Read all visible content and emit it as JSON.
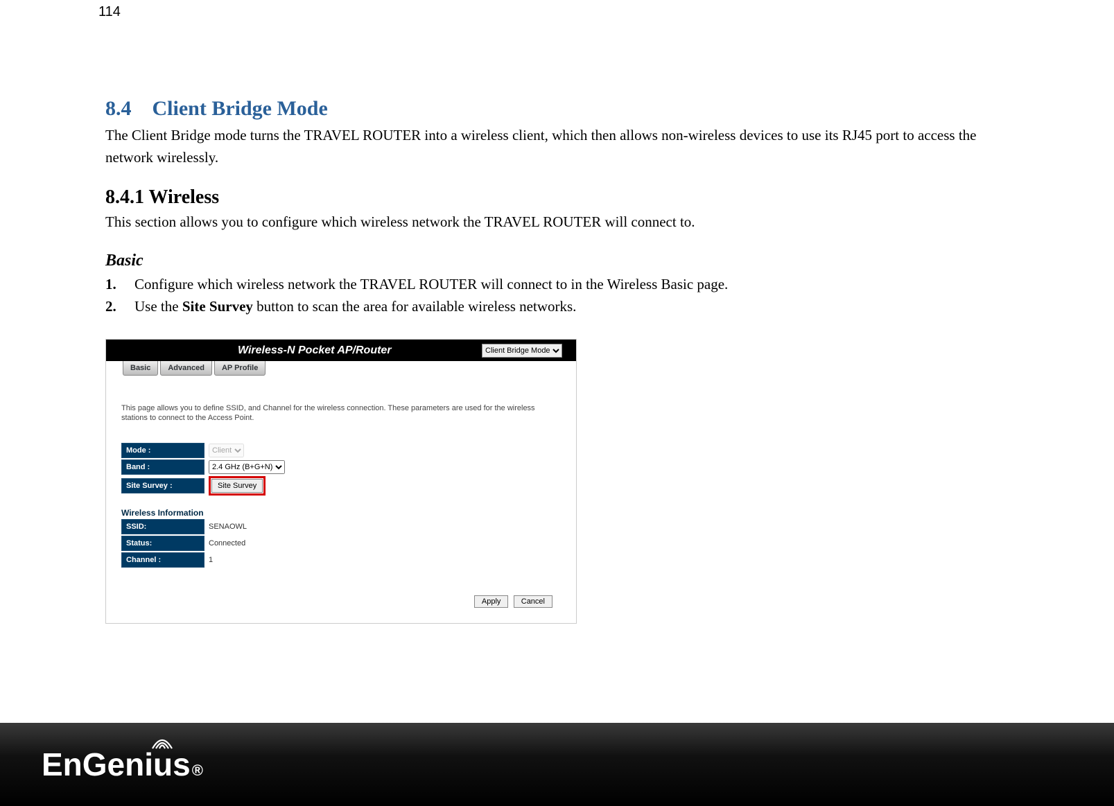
{
  "page_number": "114",
  "section": {
    "num": "8.4",
    "title": "Client Bridge Mode",
    "intro": "The Client Bridge mode turns the TRAVEL ROUTER into a wireless client, which then allows non-wireless devices to use its RJ45 port to access the network wirelessly."
  },
  "subsection": {
    "num_title": "8.4.1 Wireless",
    "intro": "This section allows you to configure which wireless network the TRAVEL ROUTER will connect to."
  },
  "basic": {
    "heading": "Basic",
    "steps": [
      {
        "n": "1.",
        "text": "Configure which wireless network the TRAVEL ROUTER will connect to in the Wireless Basic page."
      },
      {
        "n": "2.",
        "prefix": "Use the ",
        "bold": "Site Survey",
        "suffix": " button to scan the area for available wireless networks."
      }
    ]
  },
  "screenshot": {
    "title": "Wireless-N Pocket AP/Router",
    "mode_select": "Client Bridge Mode",
    "tabs": [
      "Basic",
      "Advanced",
      "AP Profile"
    ],
    "description": "This page allows you to define SSID, and Channel for the wireless connection. These parameters are used for the wireless stations to connect to the Access Point.",
    "fields": {
      "mode": {
        "label": "Mode :",
        "value": "Client"
      },
      "band": {
        "label": "Band :",
        "value": "2.4 GHz (B+G+N)"
      },
      "survey": {
        "label": "Site Survey :",
        "button": "Site Survey"
      }
    },
    "info_heading": "Wireless Information",
    "info": {
      "ssid": {
        "label": "SSID:",
        "value": "SENAOWL"
      },
      "status": {
        "label": "Status:",
        "value": "Connected"
      },
      "channel": {
        "label": "Channel :",
        "value": "1"
      }
    },
    "buttons": {
      "apply": "Apply",
      "cancel": "Cancel"
    }
  },
  "footer": {
    "brand": "EnGenius",
    "reg": "®"
  }
}
